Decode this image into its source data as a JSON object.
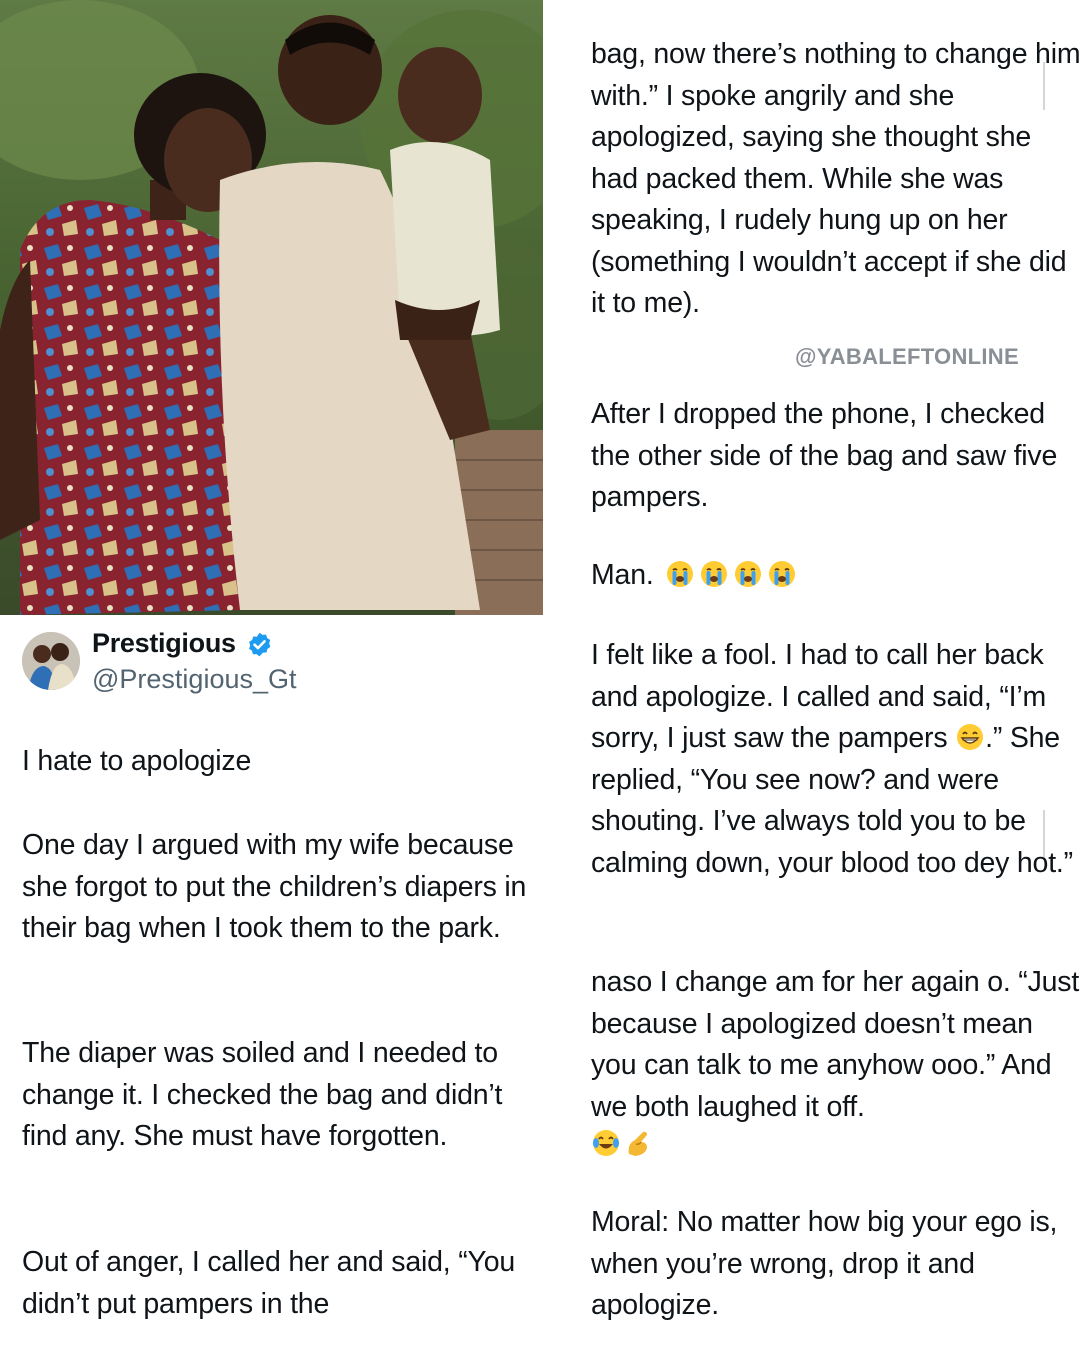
{
  "tweet": {
    "author": {
      "display_name": "Prestigious",
      "handle": "@Prestigious_Gt",
      "verified": true
    },
    "left_paragraphs": [
      "I hate to apologize",
      "One day I argued with my wife because she forgot to put the children’s diapers in their bag when I took them to the park.",
      "The diaper was soiled and I needed to change it. I checked the bag and didn’t find any. She must have forgotten.",
      "Out of anger, I called her and said, “You didn’t put pampers in the"
    ],
    "right_paragraphs": {
      "p1": "bag, now there’s nothing to change him with.” I spoke angrily and she apologized, saying she thought she had packed them. While she was speaking, I rudely hung up on her (something I wouldn’t accept if she did it to me).",
      "p2": "After I dropped the phone, I checked the other side of the bag and saw five pampers.",
      "p3": "Man.",
      "p4_before": "I felt like a fool. I had to call her back and apologize. I called and said, “I’m sorry, I just saw the pampers ",
      "p4_after": ".” She replied, “You see now? and were shouting. I’ve always told you to be calming down, your blood too dey hot.”",
      "p5": "naso I change am for her again o. “Just because I apologized doesn’t mean you can talk to me anyhow ooo.” And we both laughed it off.",
      "p6": "Moral: No matter how big your ego is, when you’re wrong, drop it and apologize."
    },
    "emojis": {
      "after_man": [
        "loudly-crying-face",
        "loudly-crying-face",
        "loudly-crying-face",
        "loudly-crying-face"
      ],
      "after_pampers": "grinning-face",
      "after_laughed": [
        "face-with-tears-of-joy",
        "pinching-hand"
      ]
    }
  },
  "watermark": "@YABALEFTONLINE",
  "colors": {
    "text": "#0f1419",
    "handle": "#536471",
    "verified": "#1d9bf0",
    "watermark": "#8a8f96"
  }
}
